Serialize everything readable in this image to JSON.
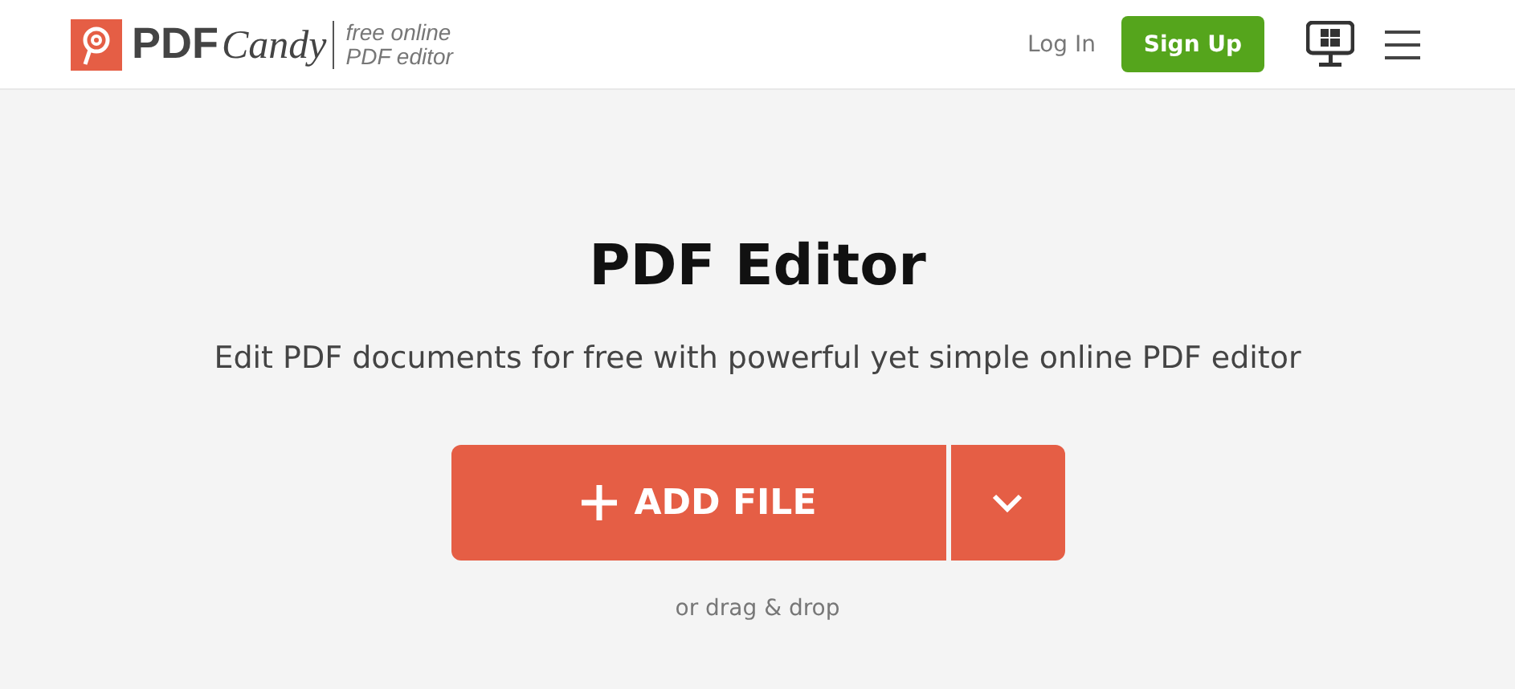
{
  "header": {
    "logo": {
      "strong": "PDF",
      "script": "Candy"
    },
    "tagline": [
      "free online",
      "PDF editor"
    ],
    "login": "Log In",
    "signup": "Sign Up"
  },
  "main": {
    "title": "PDF Editor",
    "subtitle": "Edit PDF documents for free with powerful yet simple online PDF editor",
    "add_button": "ADD FILE",
    "drop_hint": "or drag & drop"
  }
}
